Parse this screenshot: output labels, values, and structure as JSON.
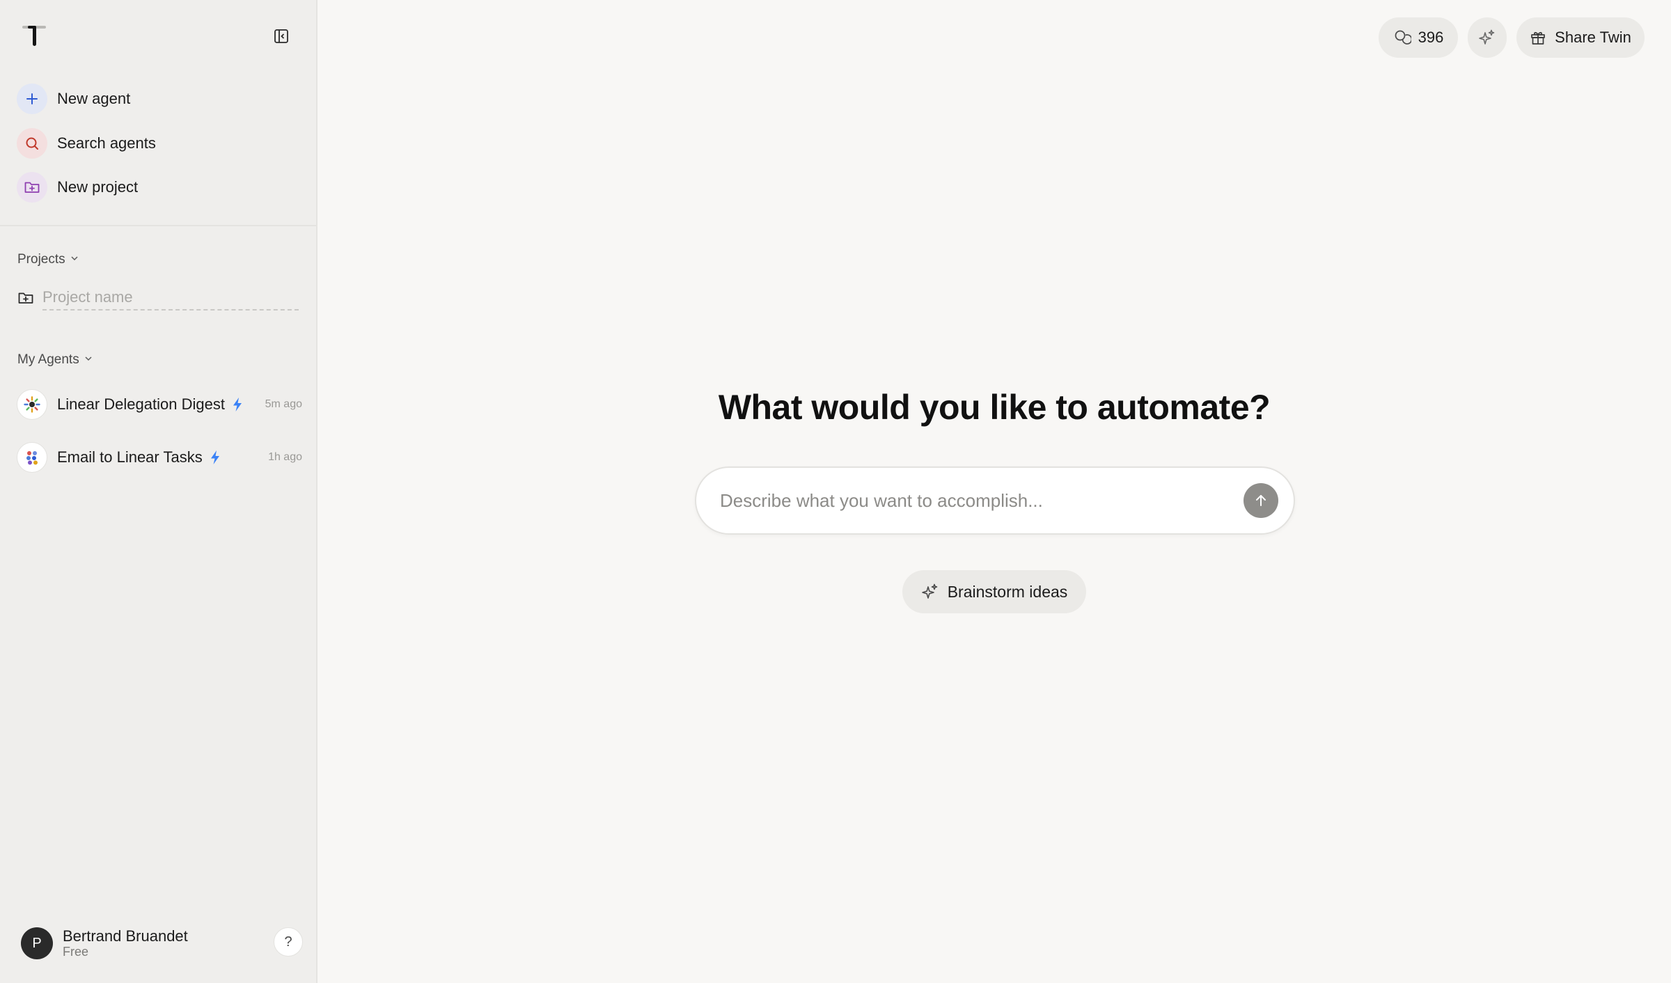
{
  "sidebar": {
    "nav": {
      "new_agent": "New agent",
      "search_agents": "Search agents",
      "new_project": "New project"
    },
    "projects": {
      "title": "Projects",
      "input_placeholder": "Project name"
    },
    "agents": {
      "title": "My Agents",
      "items": [
        {
          "name": "Linear Delegation Digest",
          "time": "5m ago"
        },
        {
          "name": "Email to Linear Tasks",
          "time": "1h ago"
        }
      ]
    },
    "user": {
      "initial": "P",
      "name": "Bertrand Bruandet",
      "plan": "Free",
      "help": "?"
    }
  },
  "topbar": {
    "credits": "396",
    "share_label": "Share Twin"
  },
  "main": {
    "headline": "What would you like to automate?",
    "prompt_placeholder": "Describe what you want to accomplish...",
    "brainstorm_label": "Brainstorm ideas"
  },
  "colors": {
    "sidebar_bg": "#efeeec",
    "main_bg": "#f8f7f5",
    "accent_blue": "#3b82f6",
    "pill_bg": "#ebeae7"
  },
  "icons": {
    "logo": "twin-logo-icon",
    "collapse": "sidebar-collapse-icon",
    "new_agent": "plus-icon",
    "search": "search-icon",
    "new_project": "folder-plus-icon",
    "trigger": "lightning-bolt-icon",
    "credits": "credits-icon",
    "sparkle": "sparkle-icon",
    "share": "gift-icon",
    "send": "arrow-up-icon"
  }
}
